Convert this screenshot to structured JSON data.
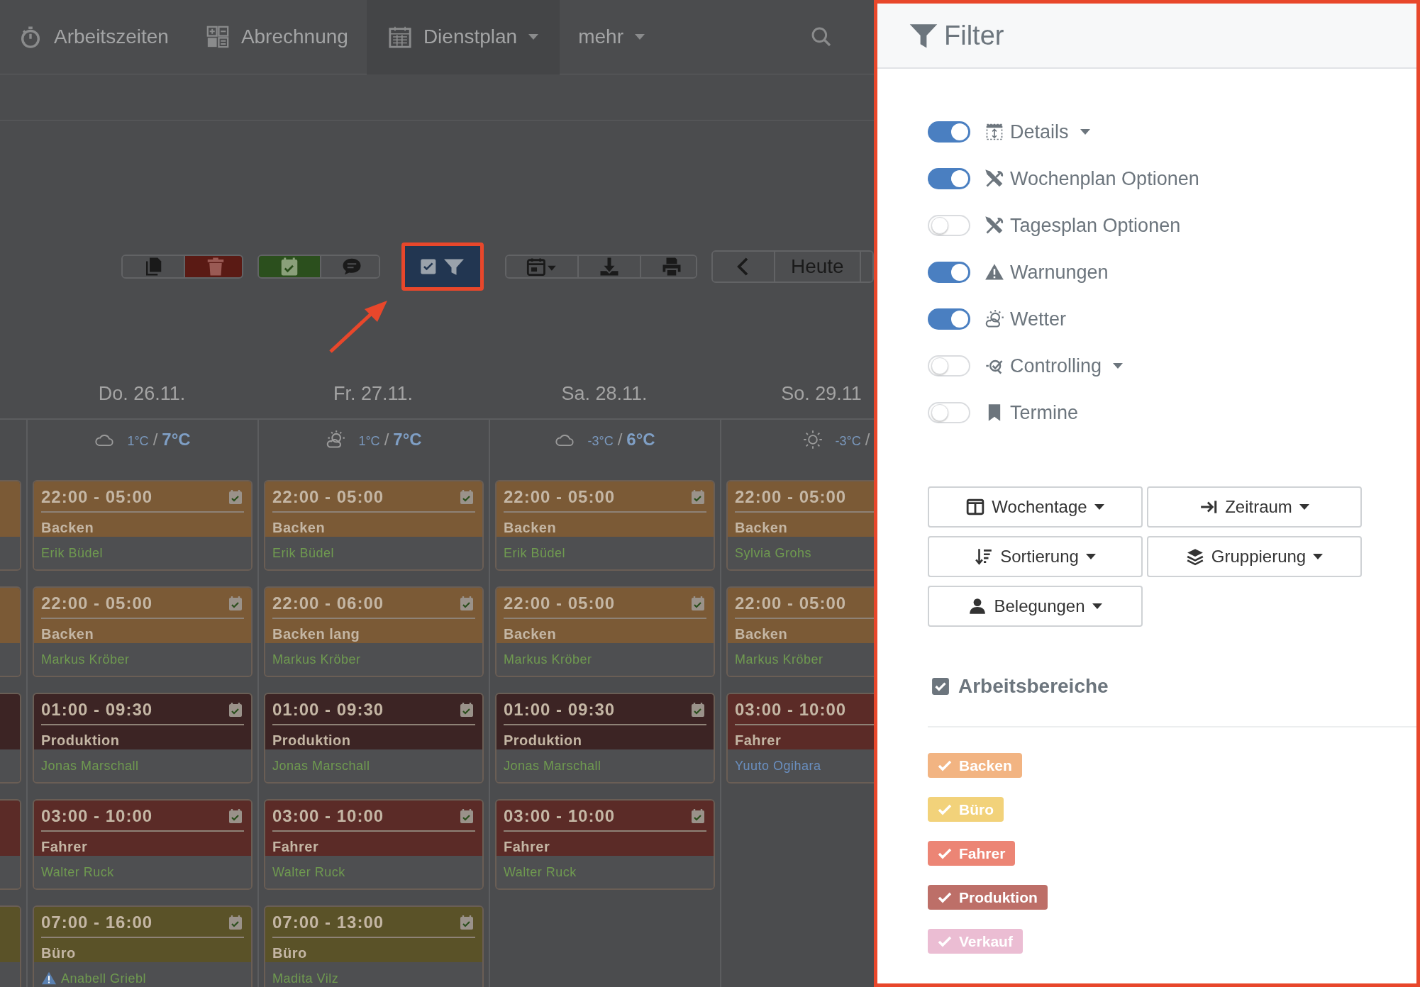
{
  "nav": [
    {
      "label": "Arbeitszeiten",
      "selected": false,
      "dropdown": false
    },
    {
      "label": "Abrechnung",
      "selected": false,
      "dropdown": false
    },
    {
      "label": "Dienstplan",
      "selected": true,
      "dropdown": true
    },
    {
      "label": "mehr",
      "selected": false,
      "dropdown": true
    }
  ],
  "toolbar": {
    "today": "Heute",
    "filter_highlighted": true
  },
  "previous_day": {
    "shifts": [
      {
        "color": "#7b5a36"
      },
      {
        "color": "#7b5a36"
      },
      {
        "color": "#3c2424"
      },
      {
        "color": "#5b2b27"
      },
      {
        "color": "#5a5228"
      }
    ]
  },
  "days": [
    {
      "label": "Do. 26.11.",
      "weather": {
        "kind": "cloudy",
        "low": "1°C",
        "sep": "/",
        "high": "7°C"
      },
      "shifts": [
        {
          "time": "22:00 - 05:00",
          "area": "Backen",
          "color": "#7b5a36",
          "person": {
            "name": "Erik Büdel",
            "color": "#6f9a50"
          },
          "warning": false
        },
        {
          "time": "22:00 - 05:00",
          "area": "Backen",
          "color": "#7b5a36",
          "person": {
            "name": "Markus Kröber",
            "color": "#6f9a50"
          },
          "warning": false
        },
        {
          "time": "01:00 - 09:30",
          "area": "Produktion",
          "color": "#3c2424",
          "person": {
            "name": "Jonas Marschall",
            "color": "#6f9a50"
          },
          "warning": false
        },
        {
          "time": "03:00 - 10:00",
          "area": "Fahrer",
          "color": "#5b2b27",
          "person": {
            "name": "Walter Ruck",
            "color": "#6f9a50"
          },
          "warning": false
        },
        {
          "time": "07:00 - 16:00",
          "area": "Büro",
          "color": "#5a5228",
          "person": {
            "name": "Anabell Griebl",
            "color": "#6f9a50"
          },
          "warning": true
        }
      ]
    },
    {
      "label": "Fr. 27.11.",
      "weather": {
        "kind": "partly-sunny",
        "low": "1°C",
        "sep": "/",
        "high": "7°C"
      },
      "shifts": [
        {
          "time": "22:00 - 05:00",
          "area": "Backen",
          "color": "#7b5a36",
          "person": {
            "name": "Erik Büdel",
            "color": "#6f9a50"
          },
          "warning": false
        },
        {
          "time": "22:00 - 06:00",
          "area": "Backen lang",
          "color": "#7b5a36",
          "person": {
            "name": "Markus Kröber",
            "color": "#6f9a50"
          },
          "warning": false
        },
        {
          "time": "01:00 - 09:30",
          "area": "Produktion",
          "color": "#3c2424",
          "person": {
            "name": "Jonas Marschall",
            "color": "#6f9a50"
          },
          "warning": false
        },
        {
          "time": "03:00 - 10:00",
          "area": "Fahrer",
          "color": "#5b2b27",
          "person": {
            "name": "Walter Ruck",
            "color": "#6f9a50"
          },
          "warning": false
        },
        {
          "time": "07:00 - 13:00",
          "area": "Büro",
          "color": "#5a5228",
          "person": {
            "name": "Madita Vilz",
            "color": "#6f9a50"
          },
          "warning": false
        }
      ]
    },
    {
      "label": "Sa. 28.11.",
      "weather": {
        "kind": "cloudy",
        "low": "-3°C",
        "sep": "/",
        "high": "6°C"
      },
      "shifts": [
        {
          "time": "22:00 - 05:00",
          "area": "Backen",
          "color": "#7b5a36",
          "person": {
            "name": "Erik Büdel",
            "color": "#6f9a50"
          },
          "warning": false
        },
        {
          "time": "22:00 - 05:00",
          "area": "Backen",
          "color": "#7b5a36",
          "person": {
            "name": "Markus Kröber",
            "color": "#6f9a50"
          },
          "warning": false
        },
        {
          "time": "01:00 - 09:30",
          "area": "Produktion",
          "color": "#3c2424",
          "person": {
            "name": "Jonas Marschall",
            "color": "#6f9a50"
          },
          "warning": false
        },
        {
          "time": "03:00 - 10:00",
          "area": "Fahrer",
          "color": "#5b2b27",
          "person": {
            "name": "Walter Ruck",
            "color": "#6f9a50"
          },
          "warning": false
        }
      ]
    },
    {
      "label": "So. 29.11",
      "weather": {
        "kind": "sunny",
        "low": "-3°C",
        "sep": "/"
      },
      "shifts": [
        {
          "time": "22:00 - 05:00",
          "area": "Backen",
          "color": "#7b5a36",
          "person": {
            "name": "Sylvia Grohs",
            "color": "#6f9a50"
          },
          "warning": false
        },
        {
          "time": "22:00 - 05:00",
          "area": "Backen",
          "color": "#7b5a36",
          "person": {
            "name": "Markus Kröber",
            "color": "#6f9a50"
          },
          "warning": false
        },
        {
          "time": "03:00 - 10:00",
          "area": "Fahrer",
          "color": "#5b2b27",
          "person": {
            "name": "Yuuto Ogihara",
            "color": "#6a8fc0"
          },
          "warning": false
        }
      ]
    }
  ],
  "filter_panel": {
    "title": "Filter",
    "toggles": [
      {
        "label": "Details",
        "on": true,
        "dropdown": true
      },
      {
        "label": "Wochenplan Optionen",
        "on": true,
        "dropdown": false
      },
      {
        "label": "Tagesplan Optionen",
        "on": false,
        "dropdown": false
      },
      {
        "label": "Warnungen",
        "on": true,
        "dropdown": false
      },
      {
        "label": "Wetter",
        "on": true,
        "dropdown": false
      },
      {
        "label": "Controlling",
        "on": false,
        "dropdown": true
      },
      {
        "label": "Termine",
        "on": false,
        "dropdown": false
      }
    ],
    "buttons": [
      "Wochentage",
      "Zeitraum",
      "Sortierung",
      "Gruppierung",
      "Belegungen"
    ],
    "areas_heading": {
      "label": "Arbeitsbereiche",
      "checked": true
    },
    "areas": [
      {
        "label": "Backen",
        "color": "#f2b482",
        "checked": true
      },
      {
        "label": "Büro",
        "color": "#f2d27a",
        "checked": true
      },
      {
        "label": "Fahrer",
        "color": "#ec8575",
        "checked": true
      },
      {
        "label": "Produktion",
        "color": "#bd6f68",
        "checked": true
      },
      {
        "label": "Verkauf",
        "color": "#ebbdd3",
        "checked": true
      }
    ]
  }
}
